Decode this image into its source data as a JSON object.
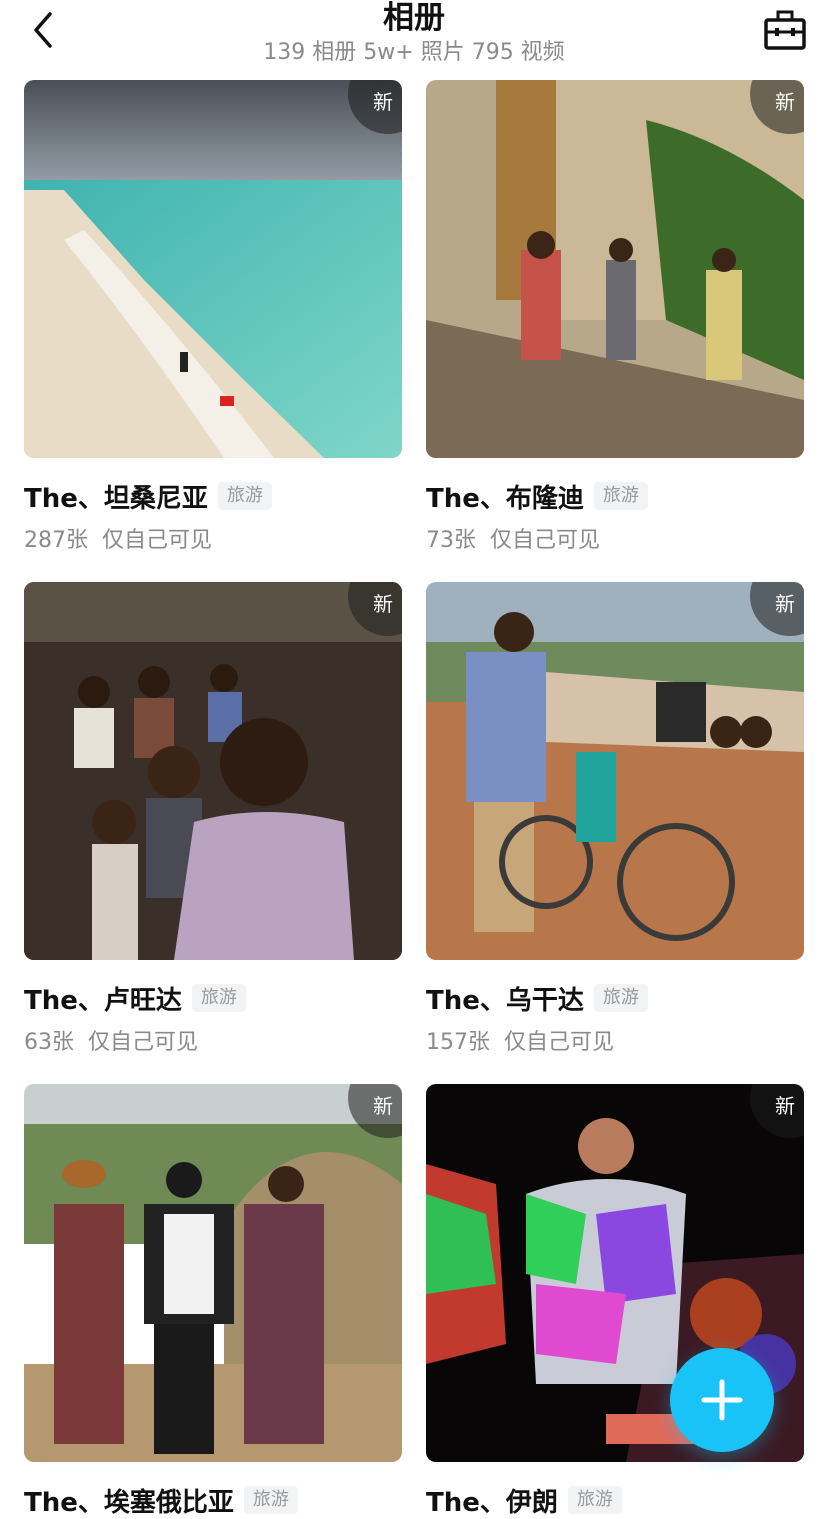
{
  "header": {
    "title": "相册",
    "subtitle": "139 相册 5w+ 照片 795 视频"
  },
  "albums": [
    {
      "name": "The、坦桑尼亚",
      "tag": "旅游",
      "count": "287张",
      "visibility": "仅自己可见",
      "badge": "新"
    },
    {
      "name": "The、布隆迪",
      "tag": "旅游",
      "count": "73张",
      "visibility": "仅自己可见",
      "badge": "新"
    },
    {
      "name": "The、卢旺达",
      "tag": "旅游",
      "count": "63张",
      "visibility": "仅自己可见",
      "badge": "新"
    },
    {
      "name": "The、乌干达",
      "tag": "旅游",
      "count": "157张",
      "visibility": "仅自己可见",
      "badge": "新"
    },
    {
      "name": "The、埃塞俄比亚",
      "tag": "旅游",
      "count": "",
      "visibility": "",
      "badge": "新"
    },
    {
      "name": "The、伊朗",
      "tag": "旅游",
      "count": "",
      "visibility": "",
      "badge": "新"
    }
  ],
  "icons": {
    "back": "back-arrow-icon",
    "tool": "toolbox-icon",
    "add": "plus-icon"
  },
  "colors": {
    "accent": "#19c3f7",
    "muted": "#8a8a8a",
    "tag_bg": "#f2f3f5"
  }
}
